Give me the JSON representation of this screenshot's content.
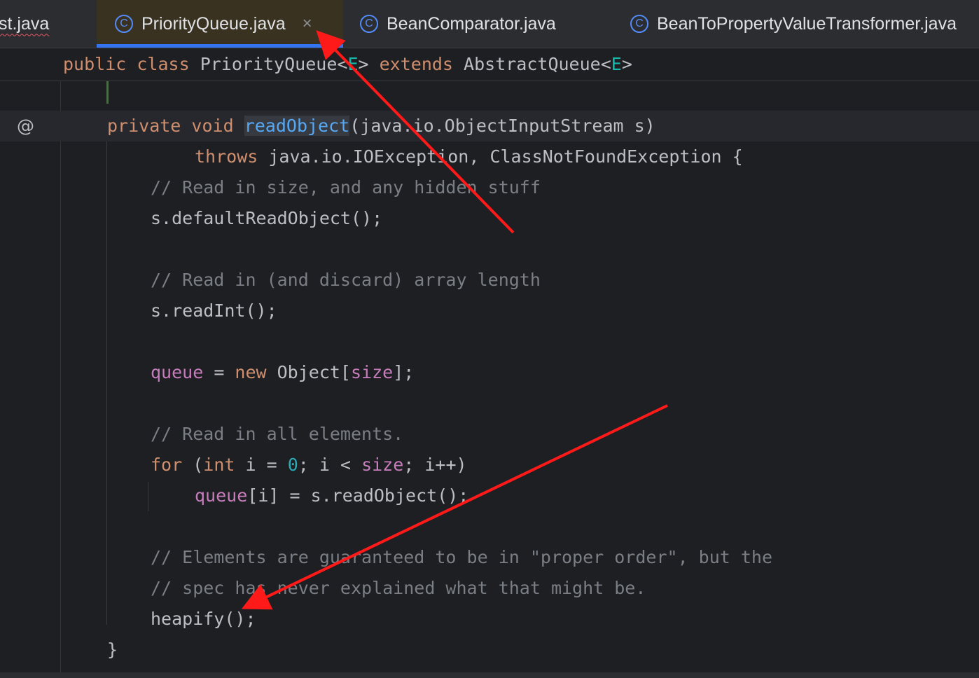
{
  "tabs": [
    {
      "label": "st.java",
      "icon": "class-icon"
    },
    {
      "label": "PriorityQueue.java",
      "icon": "class-icon",
      "active": true,
      "close": "×"
    },
    {
      "label": "BeanComparator.java",
      "icon": "class-icon"
    },
    {
      "label": "BeanToPropertyValueTransformer.java",
      "icon": "class-icon"
    }
  ],
  "class_icon_glyph": "C",
  "sticky_header": {
    "public": "public",
    "class": "class",
    "name": "PriorityQueue",
    "lt": "<",
    "E": "E",
    "gt": ">",
    "extends": "extends",
    "super": "AbstractQueue",
    "lt2": "<",
    "E2": "E",
    "gt2": ">"
  },
  "gutter": {
    "override_marker": "@"
  },
  "code": {
    "l1": {
      "private": "private",
      "void": "void",
      "method": "readObject",
      "params": "(java.io.ObjectInputStream s)"
    },
    "l2": {
      "throws": "throws",
      "rest": "java.io.IOException, ClassNotFoundException {"
    },
    "l3": "// Read in size, and any hidden stuff",
    "l4": "s.defaultReadObject();",
    "l5": "// Read in (and discard) array length",
    "l6": "s.readInt();",
    "l7": {
      "queue": "queue",
      "eq": " = ",
      "new": "new",
      "type": " Object[",
      "size": "size",
      "end": "];"
    },
    "l8": "// Read in all elements.",
    "l9": {
      "for": "for",
      "open": " (",
      "int": "int",
      "a": " i = ",
      "zero": "0",
      "b": "; i < ",
      "size": "size",
      "c": "; i++)"
    },
    "l10": {
      "queue": "queue",
      "rest": "[i] = s.readObject();"
    },
    "l11": "// Elements are guaranteed to be in \"proper order\", but the",
    "l12": "// spec has never explained what that might be.",
    "l13": "heapify();",
    "l14": "}"
  },
  "colors": {
    "keyword": "#cf8e6d",
    "field": "#c77dbb",
    "comment": "#7a7e85",
    "method": "#56a8f5",
    "number": "#2aacb8",
    "annotation_arrow": "#ff1a1a",
    "tab_accent": "#3574f0"
  }
}
